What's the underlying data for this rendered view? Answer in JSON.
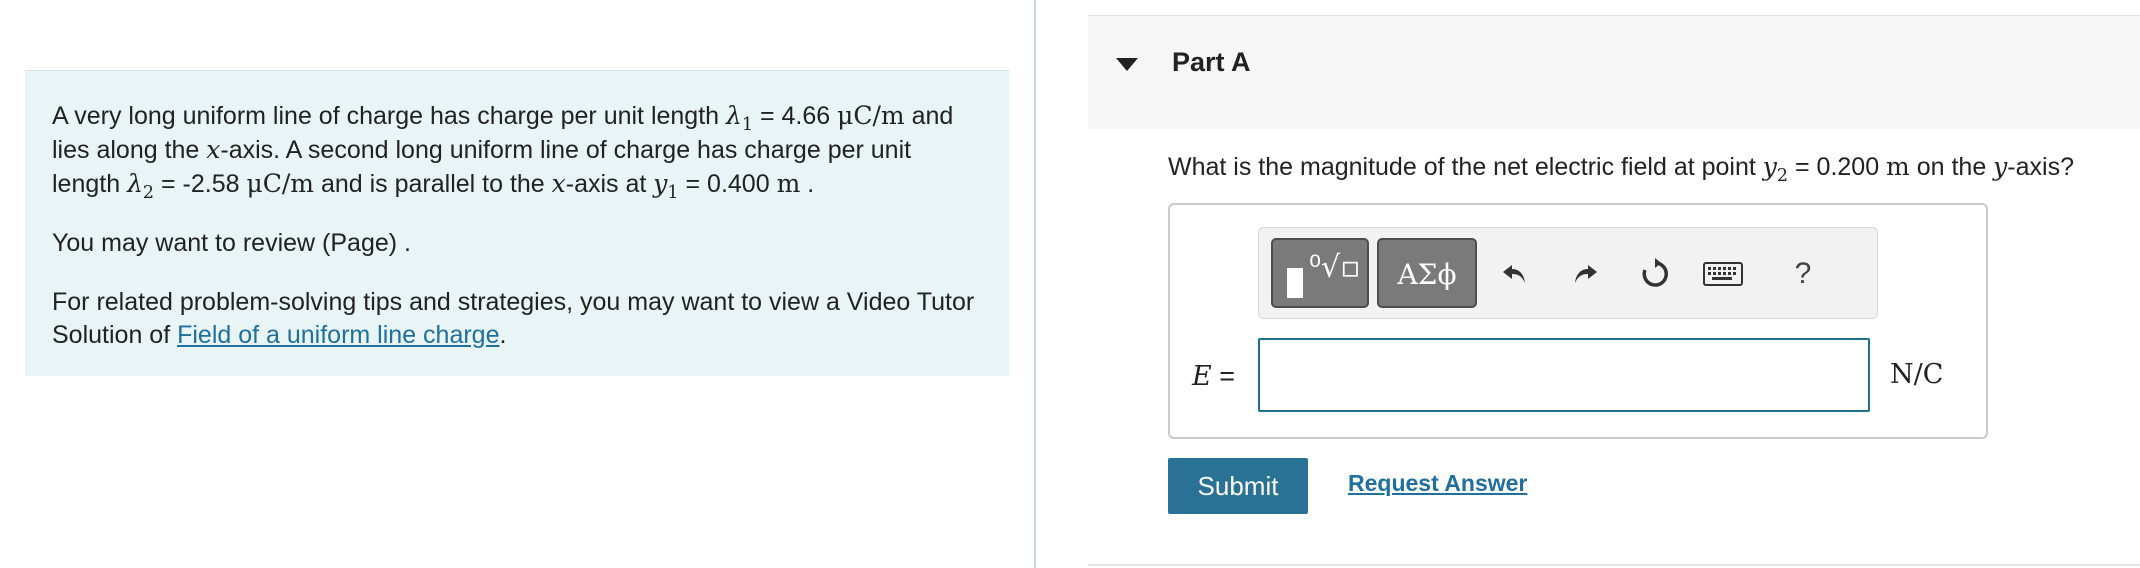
{
  "problem": {
    "p1": {
      "t1": "A very long uniform line of charge has charge per unit length ",
      "lambda": "λ",
      "sub1": "1",
      "t2": " = 4.66 ",
      "unit1": "μC/m",
      "t3": " and lies along the ",
      "xvar": "x",
      "t4": "-axis. A second long uniform line of charge has charge per unit length ",
      "lambda2": "λ",
      "sub2": "2",
      "t5": " = -2.58 ",
      "unit2": "μC/m",
      "t6": " and is parallel to the ",
      "xvar2": "x",
      "t7": "-axis at ",
      "yvar": "y",
      "sub3": "1",
      "t8": " = 0.400 ",
      "unit3": "m",
      "t9": " ."
    },
    "p2": "You may want to review (Page) .",
    "p3": {
      "text": "For related problem-solving tips and strategies, you may want to view a Video Tutor Solution of ",
      "link": "Field of a uniform line charge",
      "end": "."
    }
  },
  "part": {
    "title": "Part A",
    "question": {
      "t1": "What is the magnitude of the net electric field at point ",
      "yvar": "y",
      "sub": "2",
      "t2": " = 0.200 ",
      "unit": "m",
      "t3": " on the ",
      "yvar2": "y",
      "t4": "-axis?"
    }
  },
  "toolbar": {
    "greek_label": "ΑΣϕ",
    "help_label": "?",
    "icons": [
      "templates-icon",
      "greek-icon",
      "undo-icon",
      "redo-icon",
      "reset-icon",
      "keyboard-icon",
      "help-icon"
    ]
  },
  "answer": {
    "label_var": "E",
    "label_eq": " =",
    "value": "",
    "unit": "N/C"
  },
  "actions": {
    "submit": "Submit",
    "request": "Request Answer"
  },
  "colors": {
    "intro_bg": "#e8f4f5",
    "accent": "#2a7196",
    "link": "#1f6f9f",
    "input_border": "#1f6f8f"
  }
}
